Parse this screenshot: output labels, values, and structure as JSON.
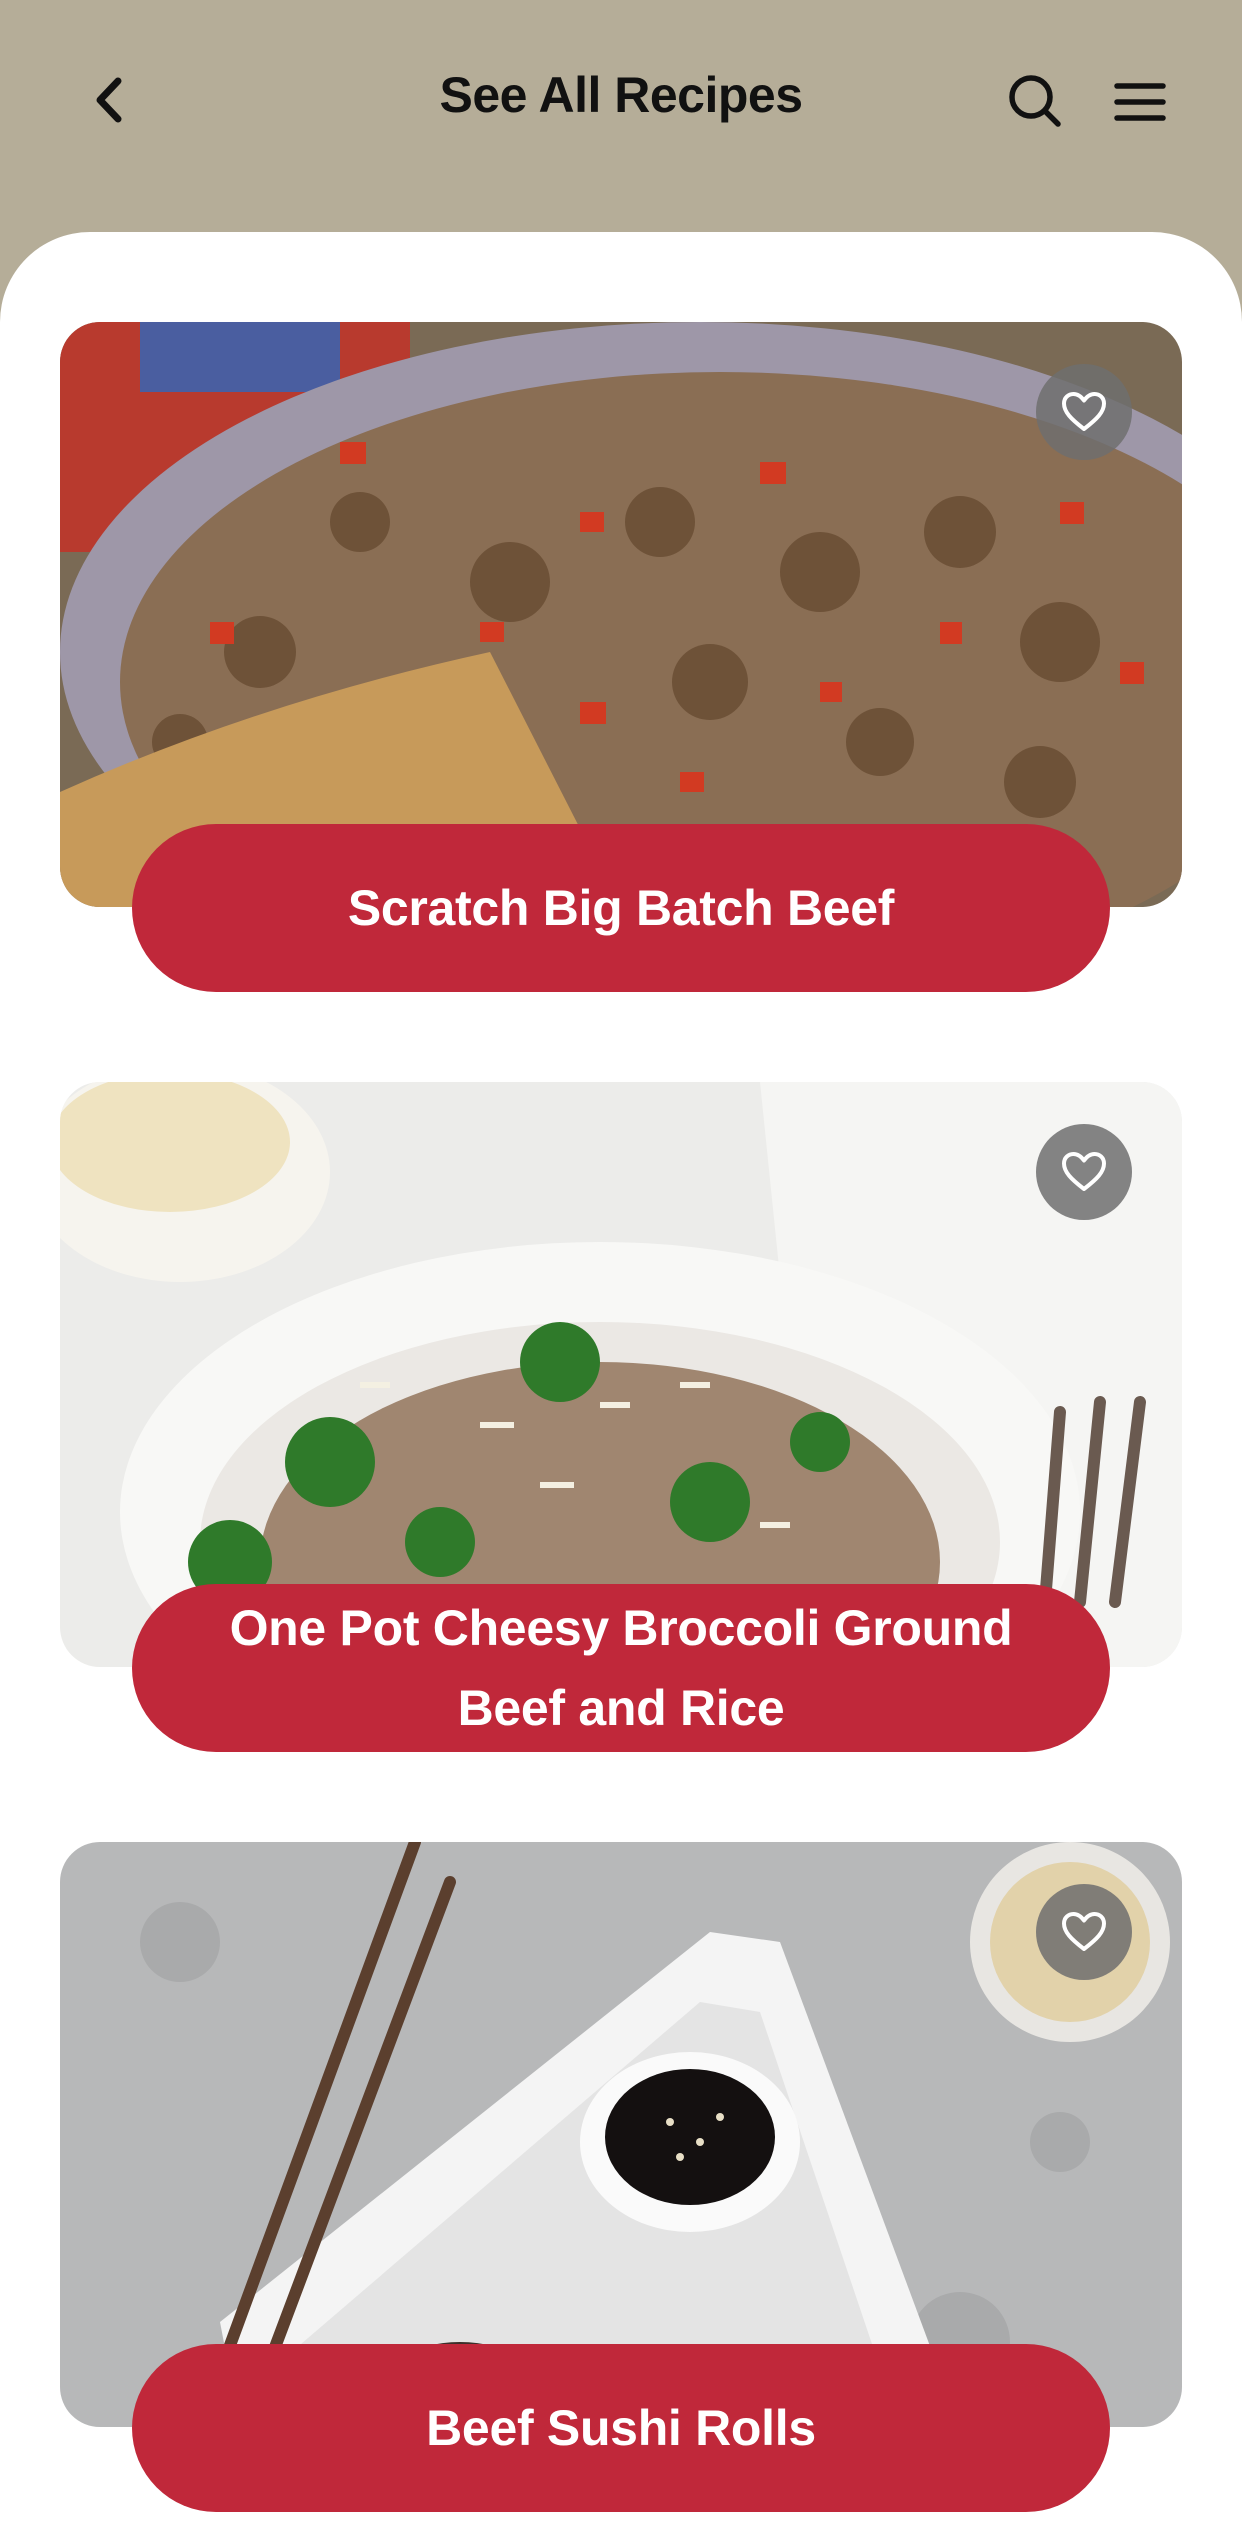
{
  "header": {
    "title": "See All Recipes",
    "back_icon": "chevron-left-icon",
    "search_icon": "search-icon",
    "menu_icon": "hamburger-menu-icon"
  },
  "colors": {
    "header_bg": "#b5ad98",
    "pill": "#c0283a",
    "fav_bg": "#6e6e6e"
  },
  "recipes": [
    {
      "title": "Scratch Big Batch Beef",
      "favorite": false,
      "image": "ground beef with peppers in pan"
    },
    {
      "title": "One Pot Cheesy Broccoli Ground Beef and Rice",
      "favorite": false,
      "image": "beef rice and broccoli in white bowl"
    },
    {
      "title": "Beef Sushi Rolls",
      "favorite": false,
      "image": "sushi rolls with soy sauce and chopsticks"
    }
  ]
}
